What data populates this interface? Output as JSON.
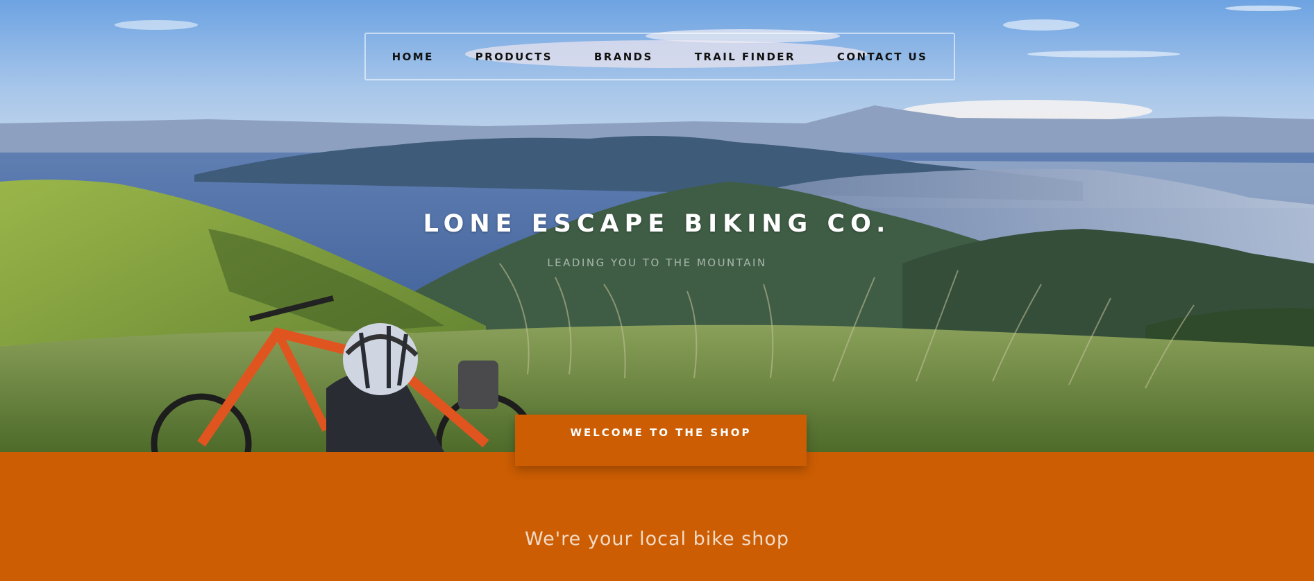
{
  "nav": {
    "items": [
      {
        "label": "HOME"
      },
      {
        "label": "PRODUCTS"
      },
      {
        "label": "BRANDS"
      },
      {
        "label": "TRAIL FINDER"
      },
      {
        "label": "CONTACT US"
      }
    ]
  },
  "hero": {
    "title": "LONE ESCAPE BIKING CO.",
    "tagline": "LEADING YOU TO THE MOUNTAIN",
    "welcome_label": "WELCOME TO THE SHOP"
  },
  "intro": {
    "heading": "We're your local bike shop"
  },
  "colors": {
    "accent": "#cc5d03",
    "sky": "#7fb0e6",
    "text_light": "#ffffff"
  }
}
